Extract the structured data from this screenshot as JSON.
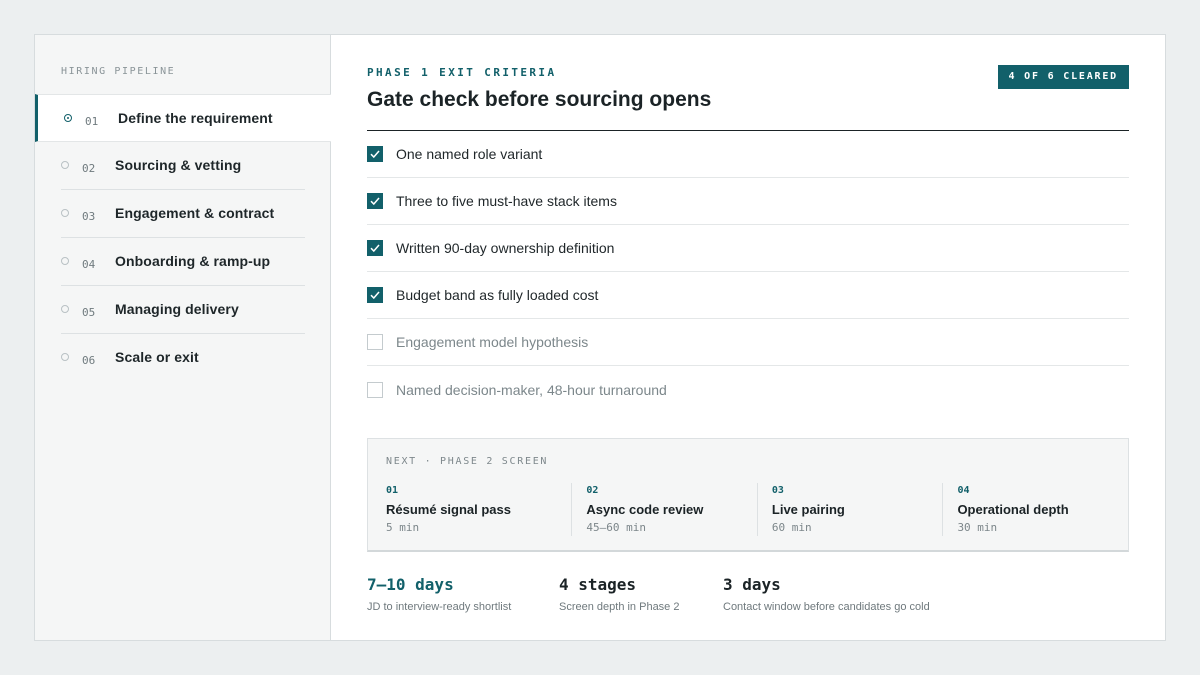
{
  "sidebar": {
    "eyebrow": "HIRING PIPELINE",
    "items": [
      {
        "num": "01",
        "label": "Define the requirement",
        "active": true
      },
      {
        "num": "02",
        "label": "Sourcing & vetting",
        "active": false
      },
      {
        "num": "03",
        "label": "Engagement & contract",
        "active": false
      },
      {
        "num": "04",
        "label": "Onboarding & ramp-up",
        "active": false
      },
      {
        "num": "05",
        "label": "Managing delivery",
        "active": false
      },
      {
        "num": "06",
        "label": "Scale or exit",
        "active": false
      }
    ]
  },
  "main": {
    "eyebrow": "PHASE 1 EXIT CRITERIA",
    "title": "Gate check before sourcing opens",
    "badge": "4 OF 6 CLEARED",
    "checklist": [
      {
        "label": "One named role variant",
        "checked": true
      },
      {
        "label": "Three to five must-have stack items",
        "checked": true
      },
      {
        "label": "Written 90-day ownership definition",
        "checked": true
      },
      {
        "label": "Budget band as fully loaded cost",
        "checked": true
      },
      {
        "label": "Engagement model hypothesis",
        "checked": false
      },
      {
        "label": "Named decision-maker, 48-hour turnaround",
        "checked": false
      }
    ],
    "next": {
      "eyebrow": "NEXT · PHASE 2 SCREEN",
      "stages": [
        {
          "num": "01",
          "name": "Résumé signal pass",
          "time": "5 min"
        },
        {
          "num": "02",
          "name": "Async code review",
          "time": "45–60 min"
        },
        {
          "num": "03",
          "name": "Live pairing",
          "time": "60 min"
        },
        {
          "num": "04",
          "name": "Operational depth",
          "time": "30 min"
        }
      ]
    },
    "stats": [
      {
        "value": "7–10 days",
        "desc": "JD to interview-ready shortlist"
      },
      {
        "value": "4 stages",
        "desc": "Screen depth in Phase 2"
      },
      {
        "value": "3 days",
        "desc": "Contact window before candidates go cold"
      }
    ]
  },
  "colors": {
    "accent": "#12606a",
    "page_bg": "#eceff0",
    "sidebar_bg": "#f5f6f6",
    "text": "#1b2326",
    "muted": "#7c878b"
  }
}
